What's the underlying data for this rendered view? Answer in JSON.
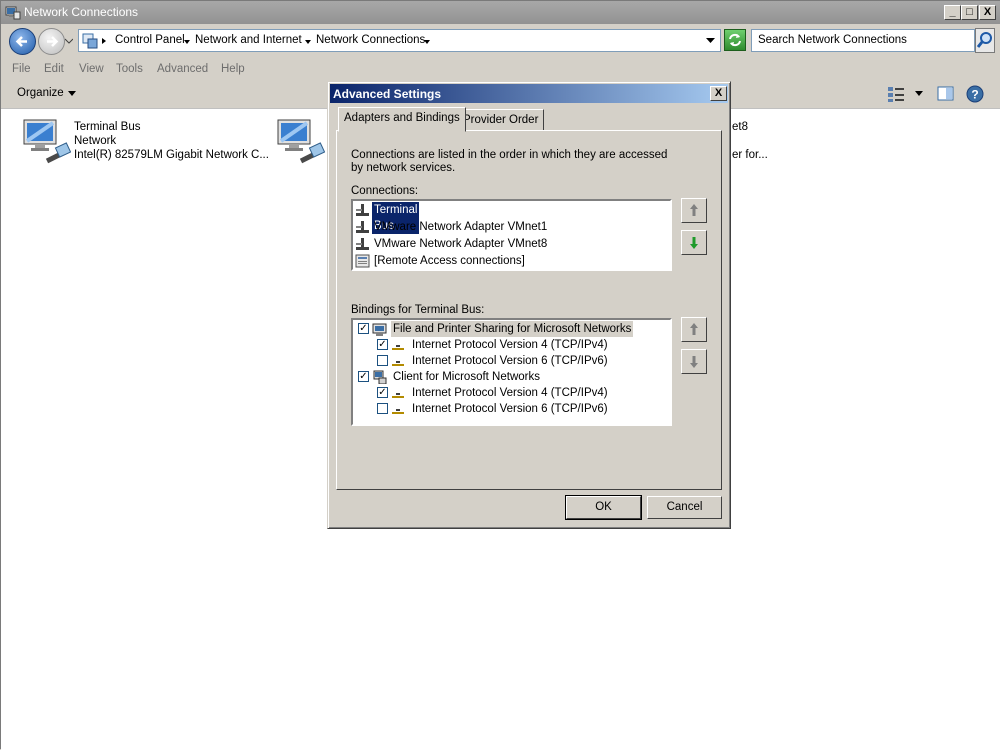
{
  "window": {
    "title": "Network Connections",
    "minimize": "_",
    "maximize": "□",
    "close": "X"
  },
  "address": {
    "crumbs": [
      "Control Panel",
      "Network and Internet",
      "Network Connections"
    ],
    "search_placeholder": "Search Network Connections"
  },
  "menu": [
    "File",
    "Edit",
    "View",
    "Tools",
    "Advanced",
    "Help"
  ],
  "toolbar": {
    "organize": "Organize"
  },
  "connections_view": [
    {
      "name": "Terminal Bus",
      "status": "Network",
      "device": "Intel(R) 82579LM Gigabit Network C..."
    },
    {
      "name_partial": "et8",
      "device_partial": "er for..."
    }
  ],
  "dialog": {
    "title": "Advanced Settings",
    "close": "X",
    "tabs": [
      "Adapters and Bindings",
      "Provider Order"
    ],
    "intro": "Connections are listed in the order in which they are accessed by network services.",
    "connections_label": "Connections:",
    "connections": [
      {
        "label": "Terminal Bus",
        "selected": true
      },
      {
        "label": "VMware Network Adapter VMnet1",
        "selected": false
      },
      {
        "label": "VMware Network Adapter VMnet8",
        "selected": false
      },
      {
        "label": "[Remote Access connections]",
        "selected": false
      }
    ],
    "bindings_label": "Bindings for Terminal Bus:",
    "bindings": [
      {
        "label": "File and Printer Sharing for Microsoft Networks",
        "checked": true,
        "level": 0
      },
      {
        "label": "Internet Protocol Version 4 (TCP/IPv4)",
        "checked": true,
        "level": 1
      },
      {
        "label": "Internet Protocol Version 6 (TCP/IPv6)",
        "checked": false,
        "level": 1
      },
      {
        "label": "Client for Microsoft Networks",
        "checked": true,
        "level": 0
      },
      {
        "label": "Internet Protocol Version 4 (TCP/IPv4)",
        "checked": true,
        "level": 1
      },
      {
        "label": "Internet Protocol Version 6 (TCP/IPv6)",
        "checked": false,
        "level": 1
      }
    ],
    "ok": "OK",
    "cancel": "Cancel"
  },
  "colors": {
    "dialog_title_start": "#0a246a",
    "dialog_title_end": "#a6caf0",
    "selection": "#0a246a",
    "chrome": "#d4d0c8"
  }
}
